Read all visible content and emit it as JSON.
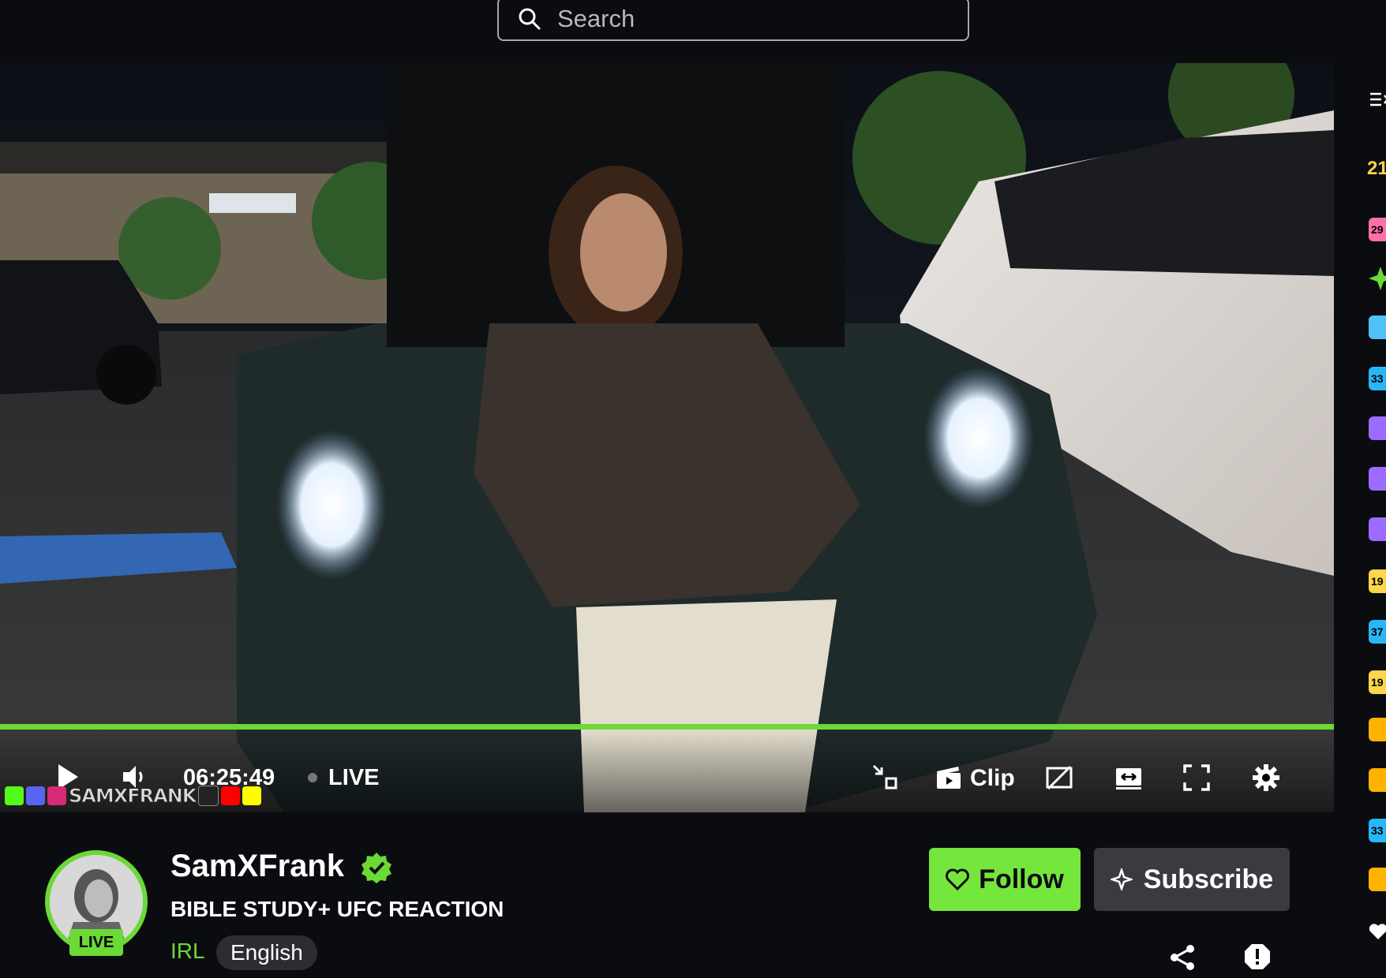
{
  "search": {
    "placeholder": "Search"
  },
  "player": {
    "time": "06:25:49",
    "live_label": "LIVE",
    "clip_label": "Clip",
    "overlay_tag": "SAMXFRANK",
    "progress_color": "#6bd936"
  },
  "channel": {
    "name": "SamXFrank",
    "verified": true,
    "avatar_live_label": "LIVE",
    "stream_title": "BIBLE STUDY+ UFC REACTION",
    "category": "IRL",
    "language": "English"
  },
  "actions": {
    "follow_label": "Follow",
    "subscribe_label": "Subscribe"
  },
  "rail": {
    "top_number": "21",
    "badges": [
      "29",
      "33",
      "19",
      "37",
      "19",
      "33"
    ]
  },
  "colors": {
    "accent": "#6bd936",
    "follow_bg": "#75e63c",
    "subscribe_bg": "#3a3b41",
    "background": "#0b0c10"
  }
}
